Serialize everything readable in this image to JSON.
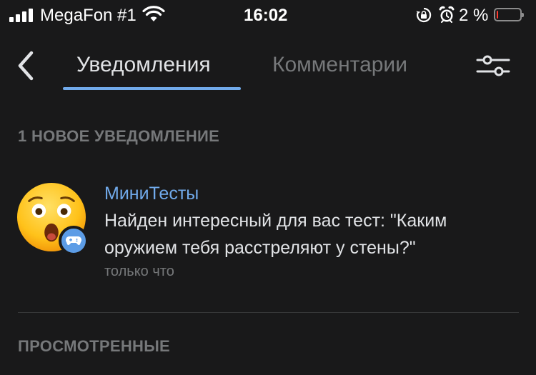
{
  "status_bar": {
    "carrier": "MegaFon #1",
    "time": "16:02",
    "battery_percent": "2 %",
    "battery_level": 0.02,
    "icons": [
      "signal-icon",
      "wifi-icon",
      "rotation-lock-icon",
      "alarm-icon",
      "battery-icon"
    ]
  },
  "header": {
    "back_icon": "chevron-left-icon",
    "tabs": [
      {
        "label": "Уведомления",
        "active": true
      },
      {
        "label": "Комментарии",
        "active": false
      }
    ],
    "filter_icon": "sliders-icon"
  },
  "sections": {
    "new_title": "1 НОВОЕ УВЕДОМЛЕНИЕ",
    "viewed_title": "ПРОСМОТРЕННЫЕ"
  },
  "notification": {
    "sender": "МиниТесты",
    "text": "Найден интересный для вас тест: \"Каким оружием тебя расстреляют у стены?\"",
    "time": "только что",
    "avatar_icon": "astonished-face-emoji",
    "badge_icon": "gamepad-icon"
  },
  "colors": {
    "background": "#19191a",
    "accent": "#71aaeb",
    "text_primary": "#e1e3e6",
    "text_secondary": "#76787a",
    "battery_low": "#ff3b30"
  }
}
